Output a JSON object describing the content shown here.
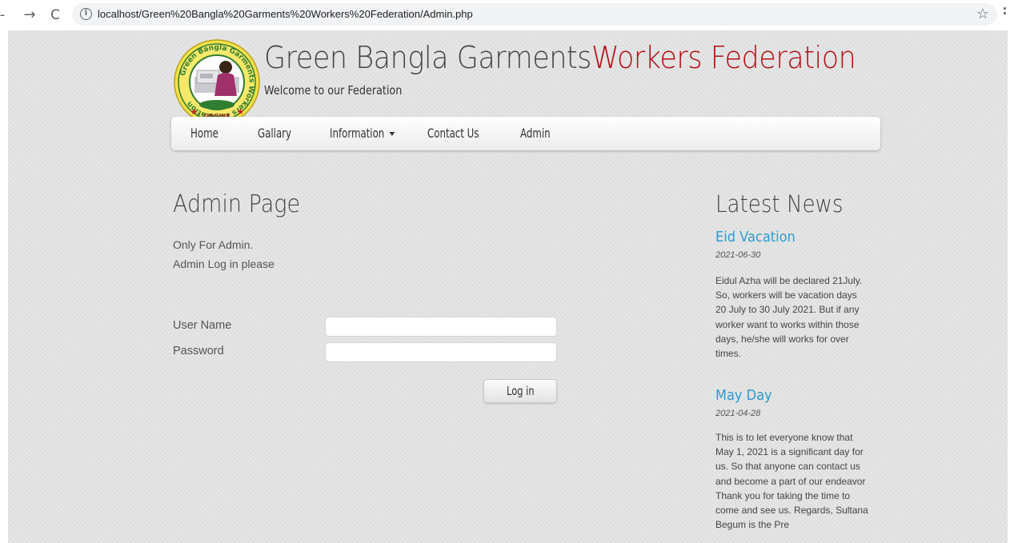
{
  "browser": {
    "back_icon": "-",
    "forward_icon": "→",
    "reload_icon": "C",
    "info_icon": "i",
    "url": "localhost/Green%20Bangla%20Garments%20Workers%20Federation/Admin.php",
    "star_icon": "☆"
  },
  "header": {
    "title_main": "Green Bangla Garments",
    "title_accent": "Workers Federation",
    "tagline": "Welcome to our Federation",
    "accent_color": "#b30f17",
    "logo": {
      "ring_text": "Green Bangla Garments Workers Federation",
      "bottom_text": "GBGWF"
    }
  },
  "nav": {
    "items": [
      {
        "label": "Home"
      },
      {
        "label": "Gallary"
      },
      {
        "label": "Information"
      },
      {
        "label": "Contact Us"
      },
      {
        "label": "Admin"
      }
    ]
  },
  "main": {
    "heading": "Admin Page",
    "intro": [
      "Only For Admin.",
      "Admin Log in please"
    ],
    "form": {
      "username_label": "User Name",
      "username_value": "",
      "password_label": "Password",
      "password_value": "",
      "submit_label": "Log in"
    }
  },
  "sidebar": {
    "heading": "Latest News",
    "link_color": "#2d9bd1",
    "news": [
      {
        "title": "Eid Vacation",
        "date": "2021-06-30",
        "body": "Eidul Azha will be declared 21July. So, workers will be vacation days 20 July to 30 July 2021. But if any worker want to works within those days, he/she will works for over times."
      },
      {
        "title": "May Day",
        "date": "2021-04-28",
        "body": "This is to let everyone know that May 1, 2021 is a significant day for us. So that anyone can contact us and become a part of our endeavor Thank you for taking the time to come and see us. Regards, Sultana Begum is the Pre"
      }
    ]
  }
}
